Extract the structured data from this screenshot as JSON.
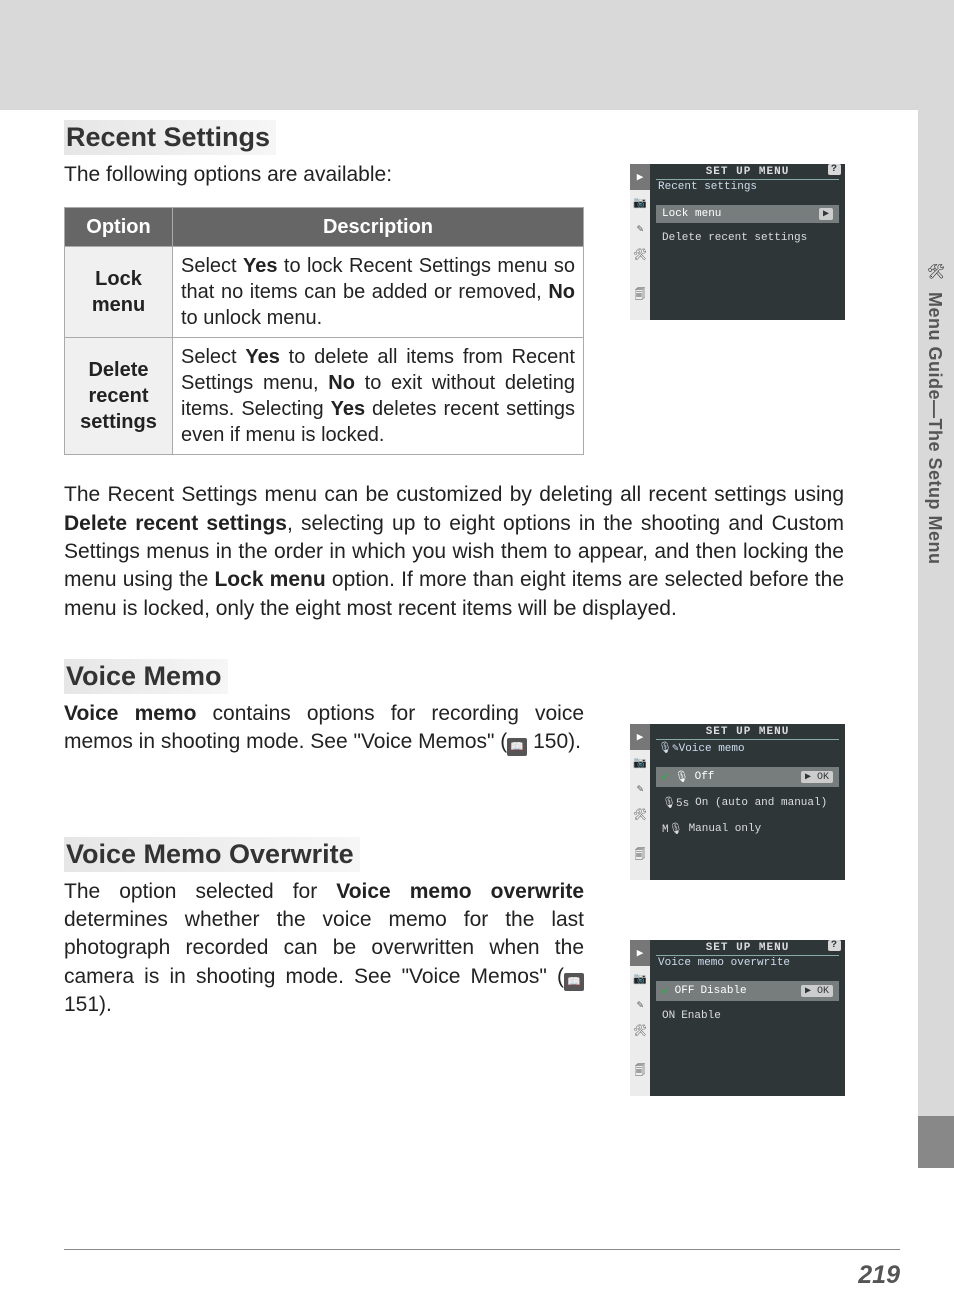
{
  "side_tab": {
    "label": "Menu Guide—The Setup Menu"
  },
  "recent_settings": {
    "heading": "Recent Settings",
    "intro": "The following options are available:",
    "table": {
      "header_option": "Option",
      "header_description": "Description",
      "rows": [
        {
          "option_l1": "Lock",
          "option_l2": "menu",
          "desc_pre1": "Select ",
          "desc_bold1": "Yes",
          "desc_mid1": " to lock Re­cent Set­tings menu so that no items can be added or re­moved, ",
          "desc_bold2": "No",
          "desc_post1": " to unlock menu."
        },
        {
          "option_l1": "Delete",
          "option_l2": "recent",
          "option_l3": "settings",
          "desc_pre1": "Select ",
          "desc_bold1": "Yes",
          "desc_mid1": " to delete all items from Recent Settings menu, ",
          "desc_bold2": "No",
          "desc_mid2": " to exit without deleting items.  Selecting ",
          "desc_bold3": "Yes",
          "desc_post1": " deletes recent settings even if menu is locked."
        }
      ]
    },
    "paragraph_pre": "The Recent Settings menu can be customized by deleting all recent settings using ",
    "paragraph_b1": "Delete recent settings",
    "paragraph_mid1": ", selecting up to eight options in the shooting and Custom Settings menus in the order in which you wish them to appear, and then locking the menu using the ",
    "paragraph_b2": "Lock menu",
    "paragraph_post": " option.  If more than eight items are selected before the menu is locked, only the eight most recent items will be displayed."
  },
  "voice_memo": {
    "heading": "Voice Memo",
    "para_b": "Voice memo",
    "para_rest": " contains options for recording voice memos in shooting mode.  See \"Voice Memos\" (",
    "page_ref": " 150)."
  },
  "voice_memo_overwrite": {
    "heading": "Voice Memo Overwrite",
    "para_pre": "The option selected for ",
    "para_b": "Voice memo overwrite",
    "para_post": " determines whether the voice memo for the last photograph recorded can be overwritten when the camera is in shooting mode.  See \"Voice Memos\" (",
    "page_ref": " 151)."
  },
  "lcd1": {
    "title": "SET UP MENU",
    "sub": "Recent settings",
    "row1": "Lock menu",
    "row2": "Delete recent settings"
  },
  "lcd2": {
    "title": "SET UP MENU",
    "sub_pre": "🎙✎",
    "sub": "Voice memo",
    "opt1_marker": "🎙",
    "opt1": "Off",
    "ok": "OK",
    "opt2_marker": "🎙5s",
    "opt2": "On (auto and manual)",
    "opt3_marker": "M🎙",
    "opt3": "Manual only"
  },
  "lcd3": {
    "title": "SET UP MENU",
    "sub": "Voice memo overwrite",
    "opt1_marker": "OFF",
    "opt1": "Disable",
    "ok": "OK",
    "opt2_marker": "ON",
    "opt2": "Enable"
  },
  "page_number": "219",
  "icon_labels": {
    "play": "▶",
    "camera": "📷",
    "pencil": "✎",
    "wrench": "🛠",
    "recent": "🗐",
    "help": "?",
    "book": "📖",
    "check": "✔",
    "arrow_right": "▶"
  }
}
